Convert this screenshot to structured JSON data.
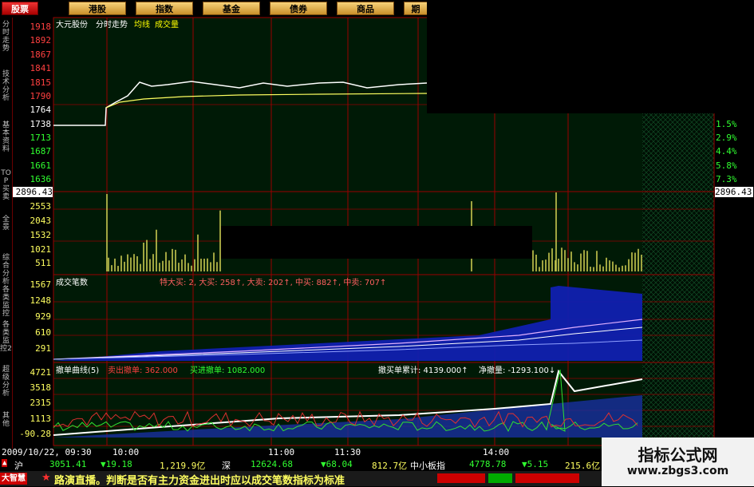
{
  "toolbar": {
    "tabs": [
      {
        "label": "股票",
        "active": true
      },
      {
        "label": "港股"
      },
      {
        "label": "指数"
      },
      {
        "label": "基金"
      },
      {
        "label": "债券"
      },
      {
        "label": "商品"
      },
      {
        "label": "期"
      }
    ]
  },
  "sidebar": {
    "tabs": [
      "分时走势",
      "技术分析",
      "基本资料",
      "TOP 买卖",
      "全景",
      "综合分析",
      "各类监控",
      "各类监控2",
      "超级分析",
      "其他"
    ]
  },
  "chart_header": {
    "stock_name": "大元股份",
    "mode": "分时走势",
    "avg_line": "均线",
    "volume": "成交量"
  },
  "price_axis": {
    "ticks": [
      "1918",
      "1892",
      "1867",
      "1841",
      "1815",
      "1790",
      "1764",
      "1738",
      "1713",
      "1687",
      "1661",
      "1636"
    ],
    "right_pct": [
      "1.5%",
      "2.9%",
      "4.4%",
      "5.8%",
      "7.3%"
    ],
    "current_left": "2896.43",
    "current_right": "2896.43"
  },
  "volume_axis": {
    "ticks": [
      "2553",
      "2043",
      "1532",
      "1021",
      "511"
    ]
  },
  "deals_panel": {
    "title": "成交笔数",
    "labels": "特大买: 2, 大买: 258↑, 大卖: 202↑, 中买: 882↑, 中卖: 707↑",
    "ticks": [
      "1567",
      "1248",
      "929",
      "610",
      "291"
    ]
  },
  "cancel_panel": {
    "title": "撤单曲线(5)",
    "sell_cancel": "卖出撤单: 362.000",
    "buy_cancel": "买进撤单: 1082.000",
    "cumulative": "撤买单累计: 4139.000↑",
    "net": "净撤量: -1293.100↓",
    "ticks": [
      "4721",
      "3518",
      "2315",
      "1113",
      "-90.28"
    ]
  },
  "time_axis": {
    "date": "2009/10/22, 09:30",
    "labels": [
      "10:00",
      "11:00",
      "11:30",
      "14:00"
    ]
  },
  "status": {
    "sh_label": "沪",
    "sh_index": "3051.41",
    "sh_change": "▼19.18",
    "sh_amount": "1,219.9亿",
    "sz_label": "深",
    "sz_index": "12624.68",
    "sz_change": "▼68.04",
    "sz_amount": "812.7亿",
    "sme_label": "中小板指",
    "sme_index": "4778.78",
    "sme_change": "▼5.15",
    "sme_amount": "215.6亿"
  },
  "news": {
    "brand": "大智慧",
    "text": "路演直播。判断是否有主力资金进出时应以成交笔数指标为标准"
  },
  "watermark": {
    "title": "指标公式网",
    "url": "www.zbgs3.com"
  },
  "colors": {
    "grid": "#9a0000",
    "price_line": "#ffffff",
    "avg_line": "#ffff00",
    "volume_bars": "#c8c850",
    "up": "#ff4040",
    "down": "#00ff00",
    "blue_area": "#1020a0"
  }
}
